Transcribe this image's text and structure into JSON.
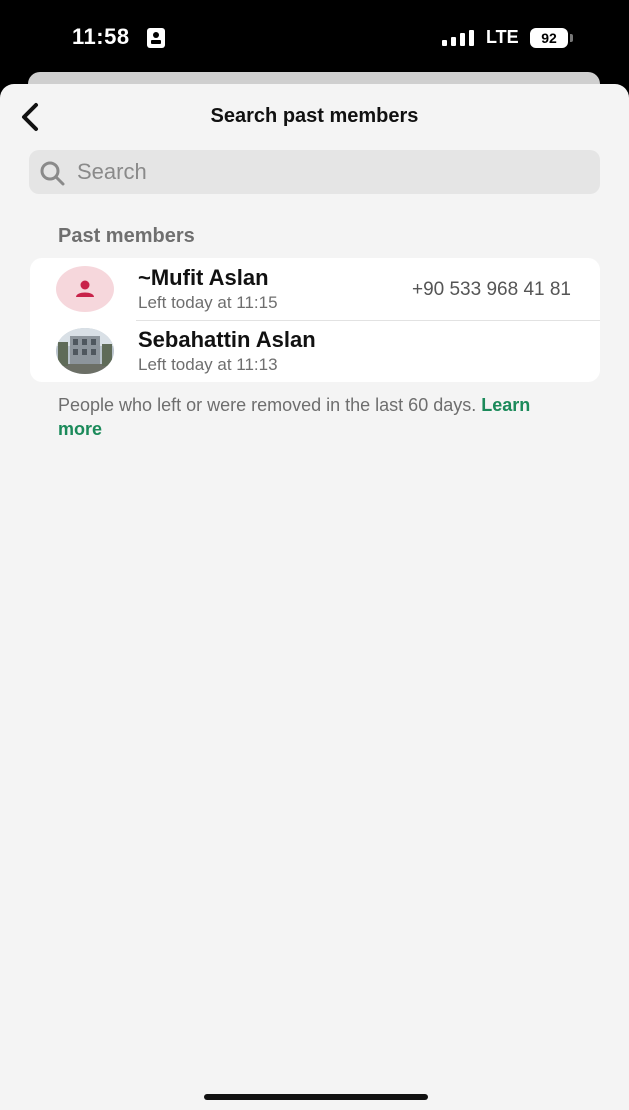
{
  "status_bar": {
    "time": "11:58",
    "network": "LTE",
    "battery": "92"
  },
  "header": {
    "title": "Search past members"
  },
  "search": {
    "placeholder": "Search"
  },
  "section": {
    "title": "Past members"
  },
  "members": [
    {
      "name": "~Mufit Aslan",
      "status": "Left today at 11:15",
      "phone": "+90 533 968 41 81",
      "avatar": "person-placeholder-icon"
    },
    {
      "name": "Sebahattin Aslan",
      "status": "Left today at 11:13",
      "avatar": "building-photo"
    }
  ],
  "footer": {
    "note": "People who left or were removed in the last 60 days.",
    "link": "Learn more"
  },
  "colors": {
    "accent": "#1b8a5a",
    "avatar_bg": "#f6d7dc",
    "avatar_icon": "#c8234a"
  }
}
